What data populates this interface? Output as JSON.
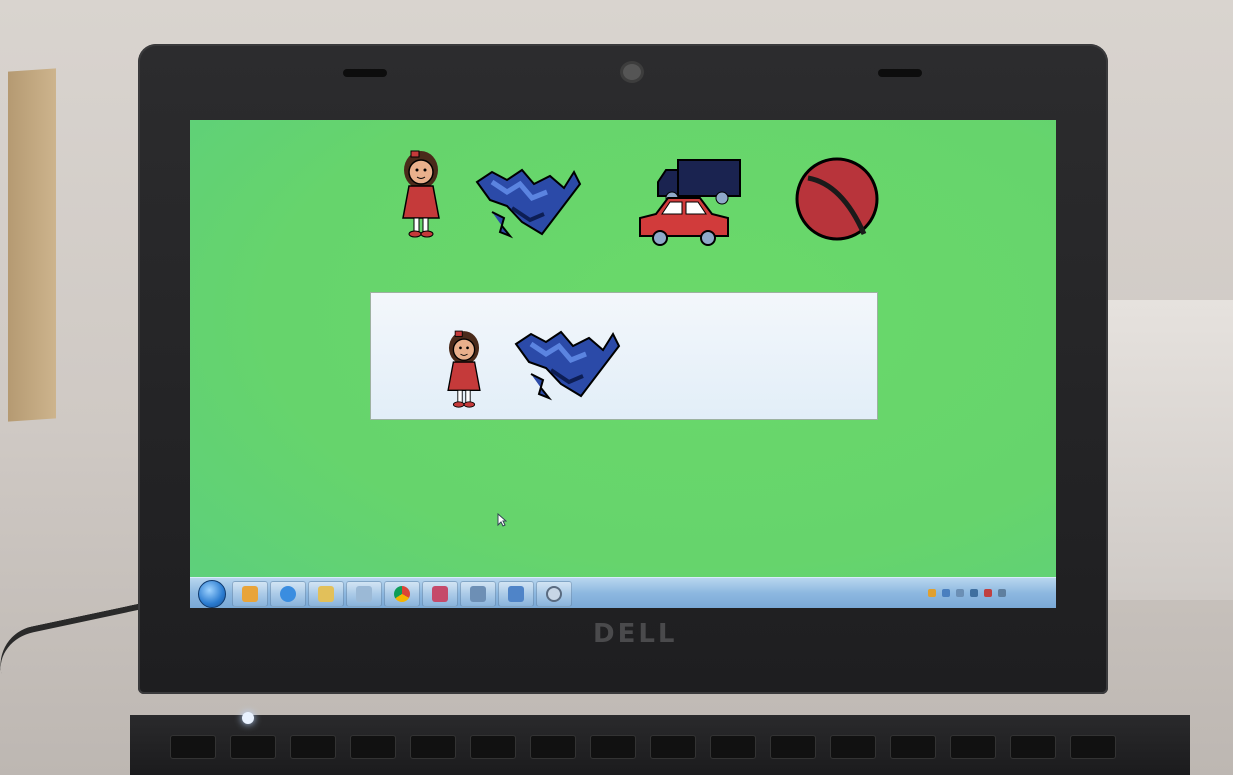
{
  "scene": {
    "device": "laptop",
    "brand": "DELL"
  },
  "screen": {
    "background_color": "#66d46c",
    "choice_symbols": [
      {
        "name": "doll-icon",
        "color": "#c53a3a"
      },
      {
        "name": "puzzle-icon",
        "color": "#2f4fb0"
      },
      {
        "name": "toy-car-truck-icon",
        "color": "#d13b3b"
      },
      {
        "name": "ball-icon",
        "color": "#b8343b"
      }
    ],
    "sentence_strip": {
      "selected_symbols": [
        "doll-icon",
        "puzzle-icon"
      ]
    }
  },
  "taskbar": {
    "pinned_icons": [
      "media-player-icon",
      "internet-explorer-icon",
      "file-explorer-icon",
      "notes-icon",
      "chrome-icon",
      "app-icon",
      "app-icon",
      "picture-app-icon",
      "search-app-icon"
    ]
  }
}
